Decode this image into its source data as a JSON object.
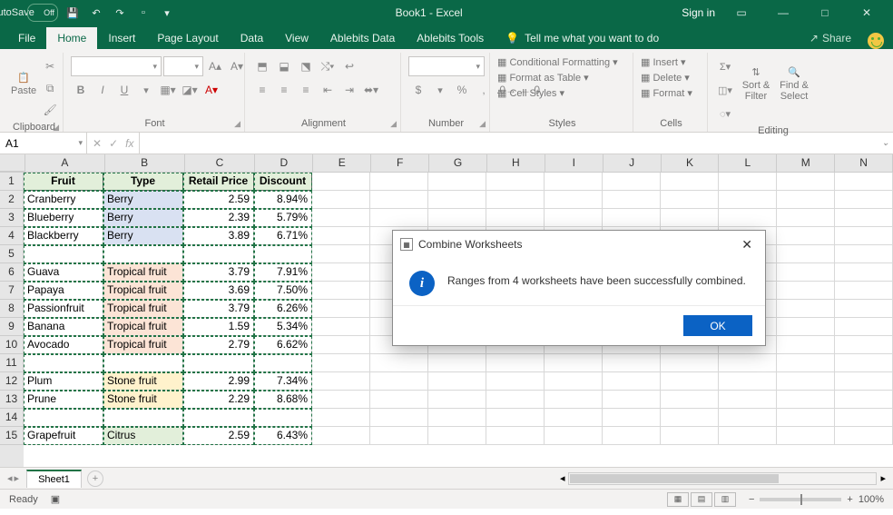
{
  "titlebar": {
    "autosave": "AutoSave",
    "autosave_state": "Off",
    "title": "Book1 - Excel",
    "signin": "Sign in"
  },
  "tabs": {
    "file": "File",
    "home": "Home",
    "insert": "Insert",
    "page_layout": "Page Layout",
    "data": "Data",
    "view": "View",
    "ablebits_data": "Ablebits Data",
    "ablebits_tools": "Ablebits Tools",
    "tell_me": "Tell me what you want to do",
    "share": "Share"
  },
  "ribbon": {
    "clipboard": {
      "label": "Clipboard",
      "paste": "Paste"
    },
    "font": {
      "label": "Font",
      "name": "",
      "size": "",
      "bold": "B",
      "italic": "I",
      "underline": "U"
    },
    "alignment": {
      "label": "Alignment"
    },
    "number": {
      "label": "Number",
      "format": "",
      "currency": "$",
      "percent": "%",
      "comma": ","
    },
    "styles": {
      "label": "Styles",
      "cond": "Conditional Formatting",
      "table": "Format as Table",
      "cell": "Cell Styles"
    },
    "cells": {
      "label": "Cells",
      "insert": "Insert",
      "delete": "Delete",
      "format": "Format"
    },
    "editing": {
      "label": "Editing",
      "sort": "Sort & Filter",
      "find": "Find & Select"
    }
  },
  "fxbar": {
    "namebox": "A1",
    "fx": "fx"
  },
  "columns": [
    "A",
    "B",
    "C",
    "D",
    "E",
    "F",
    "G",
    "H",
    "I",
    "J",
    "K",
    "L",
    "M",
    "N"
  ],
  "col_widths": [
    "wA",
    "wB",
    "wC",
    "wD",
    "wE",
    "wF",
    "wG",
    "wH",
    "wI",
    "wJ",
    "wK",
    "wL",
    "wM",
    "wN"
  ],
  "rows": [
    "1",
    "2",
    "3",
    "4",
    "5",
    "6",
    "7",
    "8",
    "9",
    "10",
    "11",
    "12",
    "13",
    "14",
    "15"
  ],
  "chart_data": {
    "type": "table",
    "headers": [
      "Fruit",
      "Type",
      "Retail Price",
      "Discount"
    ],
    "rows": [
      {
        "fruit": "Cranberry",
        "type": "Berry",
        "price": "2.59",
        "discount": "8.94%",
        "cls": "berry"
      },
      {
        "fruit": "Blueberry",
        "type": "Berry",
        "price": "2.39",
        "discount": "5.79%",
        "cls": "berry"
      },
      {
        "fruit": "Blackberry",
        "type": "Berry",
        "price": "3.89",
        "discount": "6.71%",
        "cls": "berry"
      },
      {
        "fruit": "",
        "type": "",
        "price": "",
        "discount": "",
        "cls": ""
      },
      {
        "fruit": "Guava",
        "type": "Tropical fruit",
        "price": "3.79",
        "discount": "7.91%",
        "cls": "tropical"
      },
      {
        "fruit": "Papaya",
        "type": "Tropical fruit",
        "price": "3.69",
        "discount": "7.50%",
        "cls": "tropical"
      },
      {
        "fruit": "Passionfruit",
        "type": "Tropical fruit",
        "price": "3.79",
        "discount": "6.26%",
        "cls": "tropical"
      },
      {
        "fruit": "Banana",
        "type": "Tropical fruit",
        "price": "1.59",
        "discount": "5.34%",
        "cls": "tropical"
      },
      {
        "fruit": "Avocado",
        "type": "Tropical fruit",
        "price": "2.79",
        "discount": "6.62%",
        "cls": "tropical"
      },
      {
        "fruit": "",
        "type": "",
        "price": "",
        "discount": "",
        "cls": ""
      },
      {
        "fruit": "Plum",
        "type": "Stone fruit",
        "price": "2.99",
        "discount": "7.34%",
        "cls": "stone"
      },
      {
        "fruit": "Prune",
        "type": "Stone fruit",
        "price": "2.29",
        "discount": "8.68%",
        "cls": "stone"
      },
      {
        "fruit": "",
        "type": "",
        "price": "",
        "discount": "",
        "cls": ""
      },
      {
        "fruit": "Grapefruit",
        "type": "Citrus",
        "price": "2.59",
        "discount": "6.43%",
        "cls": "citrus"
      }
    ]
  },
  "sheets": {
    "sheet1": "Sheet1"
  },
  "status": {
    "ready": "Ready",
    "zoom": "100%"
  },
  "dialog": {
    "title": "Combine Worksheets",
    "message": "Ranges from 4 worksheets have been successfully combined.",
    "ok": "OK"
  }
}
